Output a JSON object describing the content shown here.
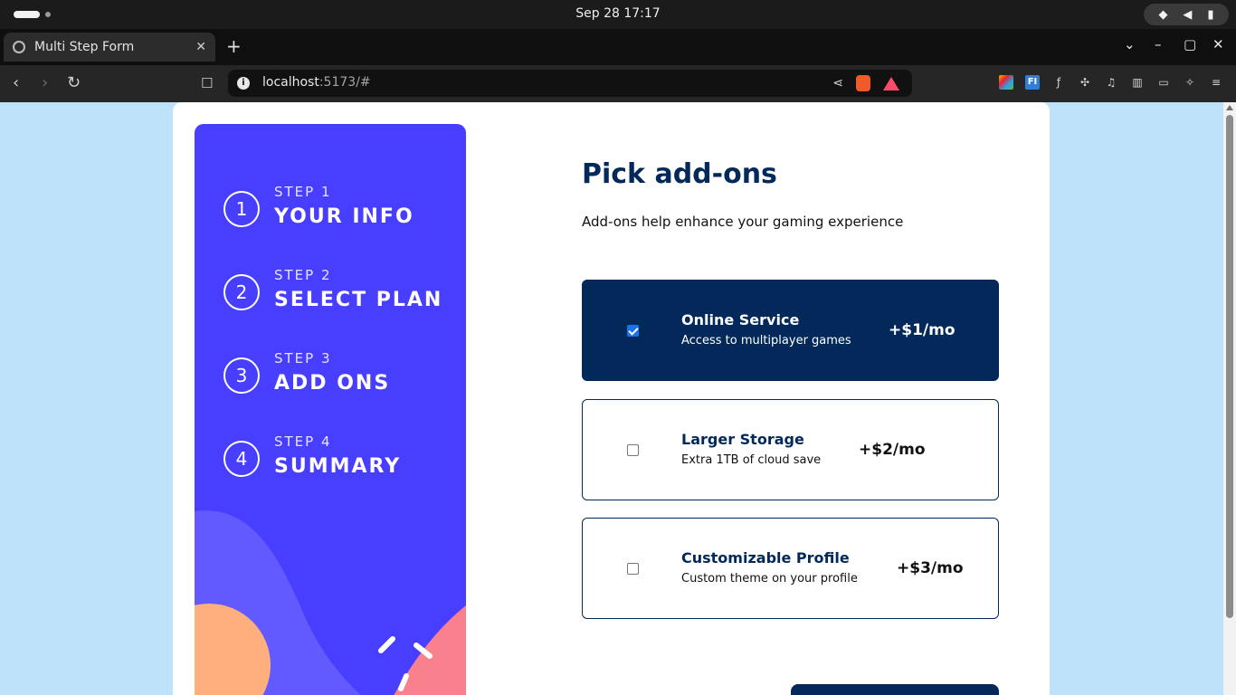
{
  "os": {
    "clock": "Sep 28  17:17",
    "tray": {
      "wifi_icon": "wifi-icon",
      "volume_icon": "volume-icon",
      "battery_icon": "battery-icon"
    }
  },
  "browser": {
    "tab_title": "Multi Step Form",
    "tab_close": "✕",
    "new_tab": "+",
    "url_host": "localhost",
    "url_rest": ":5173/#",
    "nav": {
      "back": "‹",
      "forward": "›",
      "reload": "↻"
    },
    "window": {
      "dropdown": "⌄",
      "minimize": "–",
      "maximize": "▢",
      "close": "✕"
    }
  },
  "sidebar": {
    "steps": [
      {
        "number": "1",
        "label": "STEP 1",
        "title": "YOUR INFO"
      },
      {
        "number": "2",
        "label": "STEP 2",
        "title": "SELECT PLAN"
      },
      {
        "number": "3",
        "label": "STEP 3",
        "title": "ADD ONS"
      },
      {
        "number": "4",
        "label": "STEP 4",
        "title": "SUMMARY"
      }
    ]
  },
  "main": {
    "title": "Pick add-ons",
    "subtitle": "Add-ons help enhance your gaming experience",
    "addons": [
      {
        "name": "Online Service",
        "description": "Access to multiplayer games",
        "price": "+$1/mo",
        "checked": true
      },
      {
        "name": "Larger Storage",
        "description": "Extra 1TB of cloud save",
        "price": "+$2/mo",
        "checked": false
      },
      {
        "name": "Customizable Profile",
        "description": "Custom theme on your profile",
        "price": "+$3/mo",
        "checked": false
      }
    ]
  },
  "colors": {
    "sidebar": "#483eff",
    "marine_blue": "#02295a",
    "page_background": "#bfe2fb",
    "accent_pink": "#f9818e",
    "accent_orange": "#ffaf7e"
  }
}
